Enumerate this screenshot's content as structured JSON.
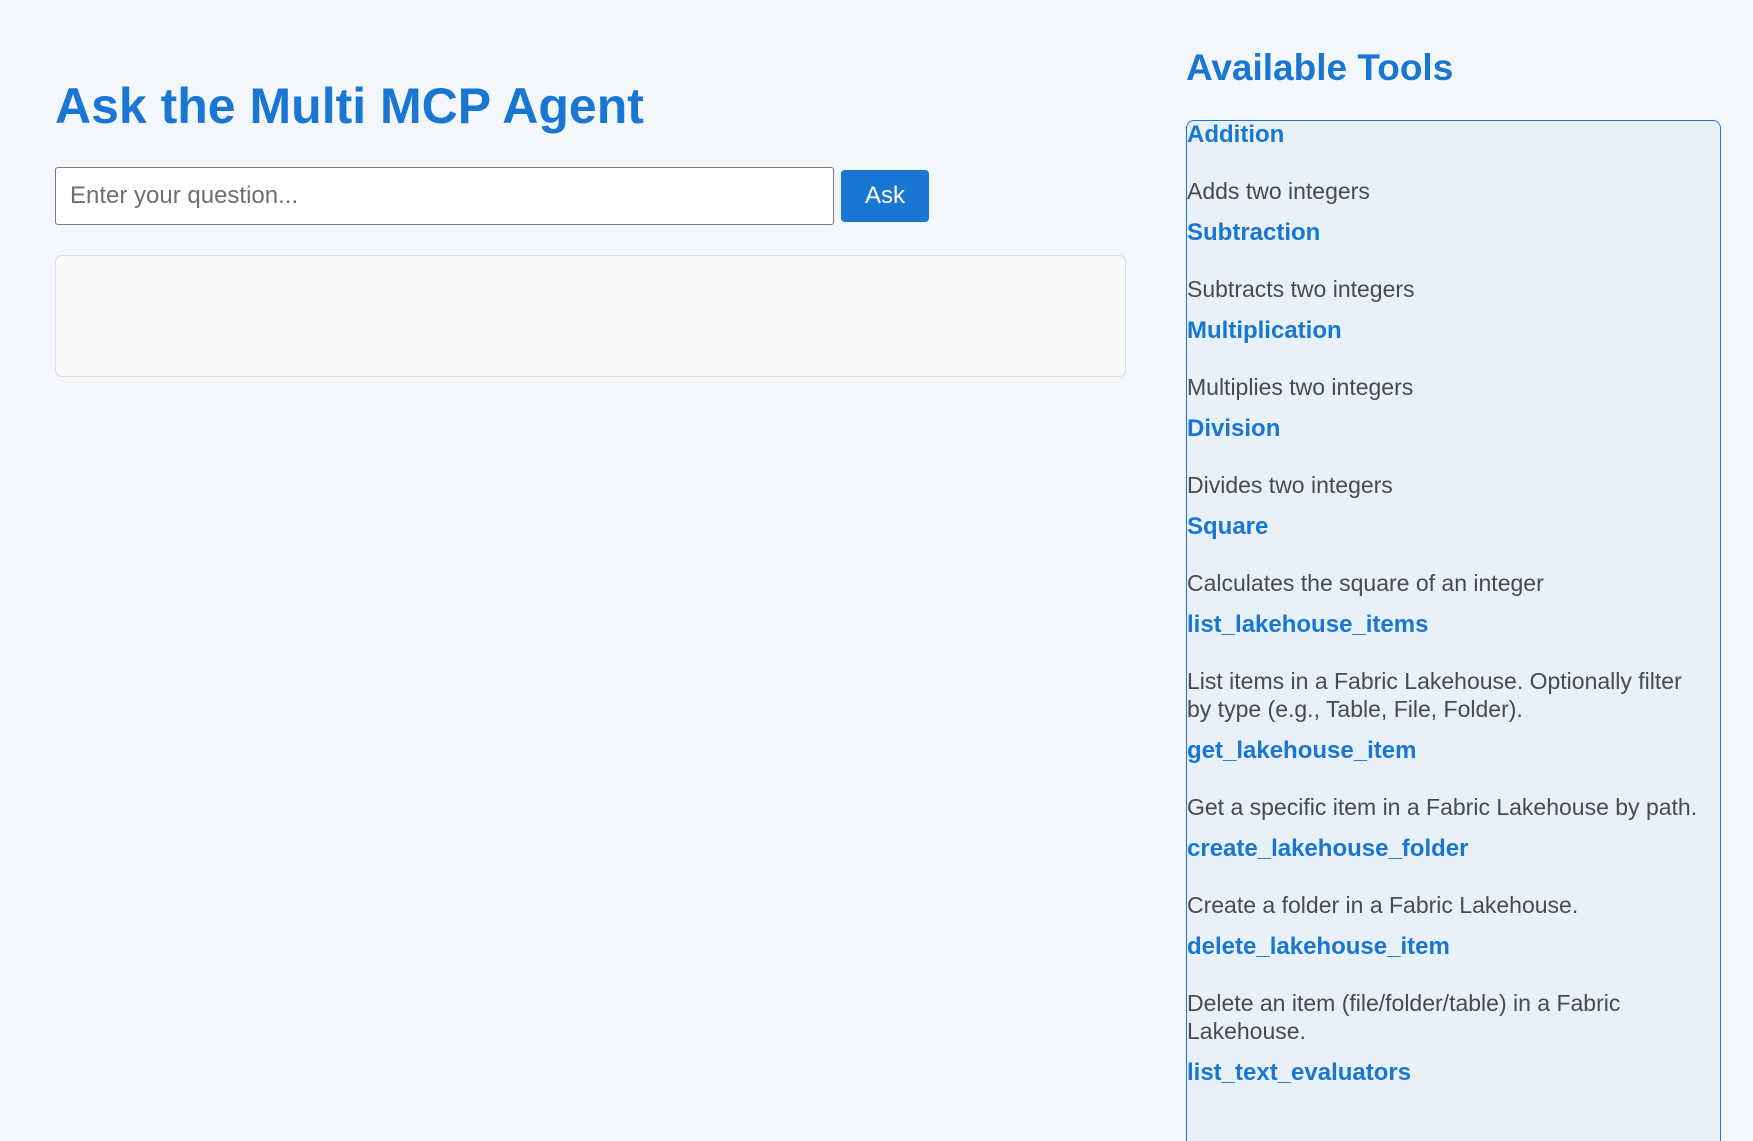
{
  "main": {
    "title": "Ask the Multi MCP Agent",
    "question_placeholder": "Enter your question...",
    "question_value": "",
    "ask_label": "Ask",
    "response_text": ""
  },
  "sidebar": {
    "title": "Available Tools",
    "tools": [
      {
        "name": "Addition",
        "description": "Adds two integers"
      },
      {
        "name": "Subtraction",
        "description": "Subtracts two integers"
      },
      {
        "name": "Multiplication",
        "description": "Multiplies two integers"
      },
      {
        "name": "Division",
        "description": "Divides two integers"
      },
      {
        "name": "Square",
        "description": "Calculates the square of an integer"
      },
      {
        "name": "list_lakehouse_items",
        "description": "List items in a Fabric Lakehouse. Optionally filter by type (e.g., Table, File, Folder)."
      },
      {
        "name": "get_lakehouse_item",
        "description": "Get a specific item in a Fabric Lakehouse by path."
      },
      {
        "name": "create_lakehouse_folder",
        "description": "Create a folder in a Fabric Lakehouse."
      },
      {
        "name": "delete_lakehouse_item",
        "description": "Delete an item (file/folder/table) in a Fabric Lakehouse."
      },
      {
        "name": "list_text_evaluators",
        "description": ""
      }
    ]
  },
  "colors": {
    "accent": "#1976d2",
    "page_background": "#f3f7fc",
    "panel_background": "#e8f0f8",
    "response_background": "#f9f9f9",
    "description_text": "#4a4a4a"
  }
}
